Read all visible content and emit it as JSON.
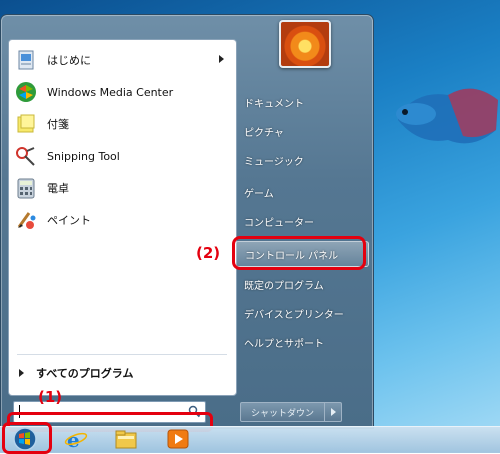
{
  "programs": [
    {
      "label": "はじめに",
      "icon": "getting-started-icon",
      "has_submenu": true
    },
    {
      "label": "Windows Media Center",
      "icon": "media-center-icon",
      "has_submenu": false
    },
    {
      "label": "付箋",
      "icon": "sticky-notes-icon",
      "has_submenu": false
    },
    {
      "label": "Snipping Tool",
      "icon": "snipping-tool-icon",
      "has_submenu": false
    },
    {
      "label": "電卓",
      "icon": "calculator-icon",
      "has_submenu": false
    },
    {
      "label": "ペイント",
      "icon": "paint-icon",
      "has_submenu": false
    }
  ],
  "all_programs_label": "すべてのプログラム",
  "search": {
    "value": "",
    "placeholder": ""
  },
  "right_items": [
    {
      "label": "ドキュメント"
    },
    {
      "label": "ピクチャ"
    },
    {
      "label": "ミュージック"
    },
    {
      "label": "ゲーム"
    },
    {
      "label": "コンピューター"
    },
    {
      "label": "コントロール パネル"
    },
    {
      "label": "既定のプログラム"
    },
    {
      "label": "デバイスとプリンター"
    },
    {
      "label": "ヘルプとサポート"
    }
  ],
  "username": "",
  "shutdown_label": "シャットダウン",
  "annotations": {
    "search_marker": "(1)",
    "control_panel_marker": "(2)"
  },
  "colors": {
    "annotation_red": "#e4000f"
  },
  "taskbar_icons": [
    "start-orb-icon",
    "internet-explorer-icon",
    "explorer-folder-icon",
    "media-player-icon"
  ]
}
